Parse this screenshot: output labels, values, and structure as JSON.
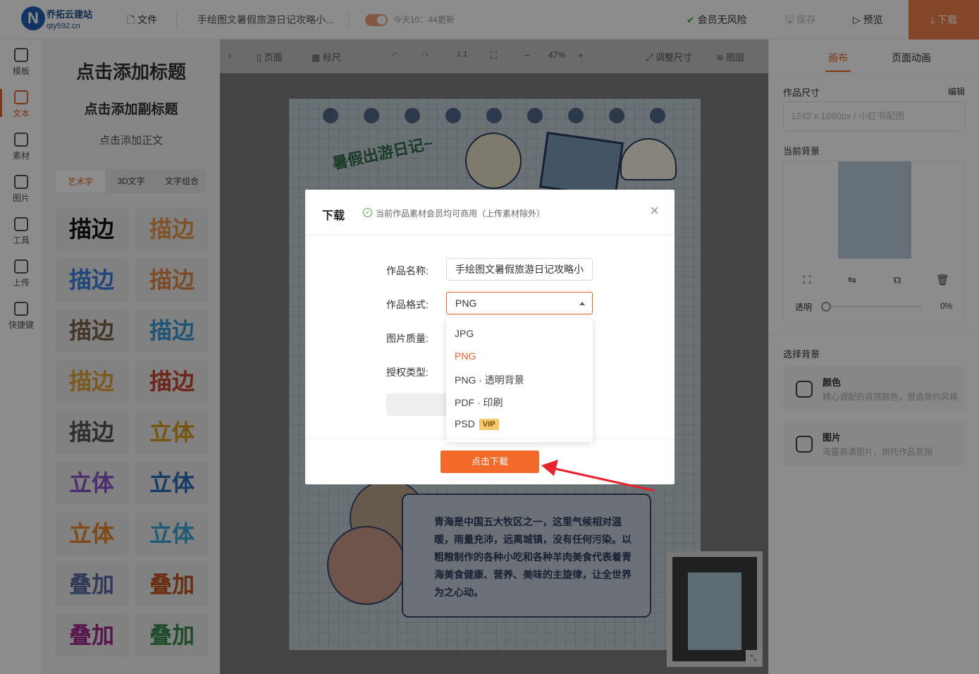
{
  "header": {
    "logo_letter": "N",
    "brand_name": "乔拓云建站",
    "brand_domain": "qty592.cn",
    "file_menu": "文件",
    "doc_title": "手绘图文暑假旅游日记攻略小...",
    "autosave": "今天10：44更新",
    "member_note": "会员无风险",
    "save_label": "保存",
    "preview_label": "预览",
    "download_label": "下载"
  },
  "rail": {
    "items": [
      {
        "label": "模板",
        "icon": "tshirt-icon"
      },
      {
        "label": "文本",
        "icon": "text-icon"
      },
      {
        "label": "素材",
        "icon": "material-icon"
      },
      {
        "label": "图片",
        "icon": "image-icon"
      },
      {
        "label": "工具",
        "icon": "toolbox-icon"
      },
      {
        "label": "上传",
        "icon": "cloud-upload-icon"
      },
      {
        "label": "快捷键",
        "icon": "keyboard-icon"
      }
    ]
  },
  "text_panel": {
    "add_title": "点击添加标题",
    "add_subtitle": "点击添加副标题",
    "add_body": "点击添加正文",
    "tabs": [
      "艺术字",
      "3D文字",
      "文字组合"
    ],
    "tiles": [
      "描边",
      "描边",
      "描边",
      "描边",
      "描边",
      "描边",
      "描边",
      "描边",
      "描边",
      "立体",
      "立体",
      "立体",
      "立体",
      "立体",
      "叠加",
      "叠加",
      "叠加",
      "叠加"
    ]
  },
  "canvas_toolbar": {
    "page": "页面",
    "ruler": "标尺",
    "ratio": "1:1",
    "zoom": "47%",
    "resize": "调整尺寸",
    "layers": "图层"
  },
  "poster": {
    "heading": "暑假出游日记~",
    "body": "青海是中国五大牧区之一，这里气候相对温暖，雨量充沛，远离城镇，没有任何污染。以粗粮制作的各种小吃和各种羊肉美食代表着青海美食健康、营养、美味的主旋律，让全世界为之心动。"
  },
  "right_panel": {
    "tab_canvas": "画布",
    "tab_animation": "页面动画",
    "size_label": "作品尺寸",
    "edit": "编辑",
    "size_value": "1242 x 1660px  / 小红书配图",
    "current_bg": "当前背景",
    "opacity_label": "透明",
    "opacity_value": "0%",
    "choose_bg": "选择背景",
    "color_title": "颜色",
    "color_desc": "精心调配的百搭颜色，营造简约风格",
    "image_title": "图片",
    "image_desc": "海量高清图片，烘托作品氛围"
  },
  "modal": {
    "title": "下载",
    "note": "当前作品素材会员均可商用（上传素材除外）",
    "name_label": "作品名称:",
    "name_value": "手绘图文暑假旅游日记攻略小",
    "format_label": "作品格式:",
    "format_value": "PNG",
    "quality_label": "图片质量:",
    "license_label": "授权类型:",
    "options": [
      "JPG",
      "PNG",
      "PNG · 透明背景",
      "PDF · 印刷",
      "PSD"
    ],
    "vip_badge": "VIP",
    "confirm": "点击下载"
  },
  "colors": {
    "accent": "#f2692a",
    "arrow": "#e8222a",
    "check": "#3cb04a"
  }
}
